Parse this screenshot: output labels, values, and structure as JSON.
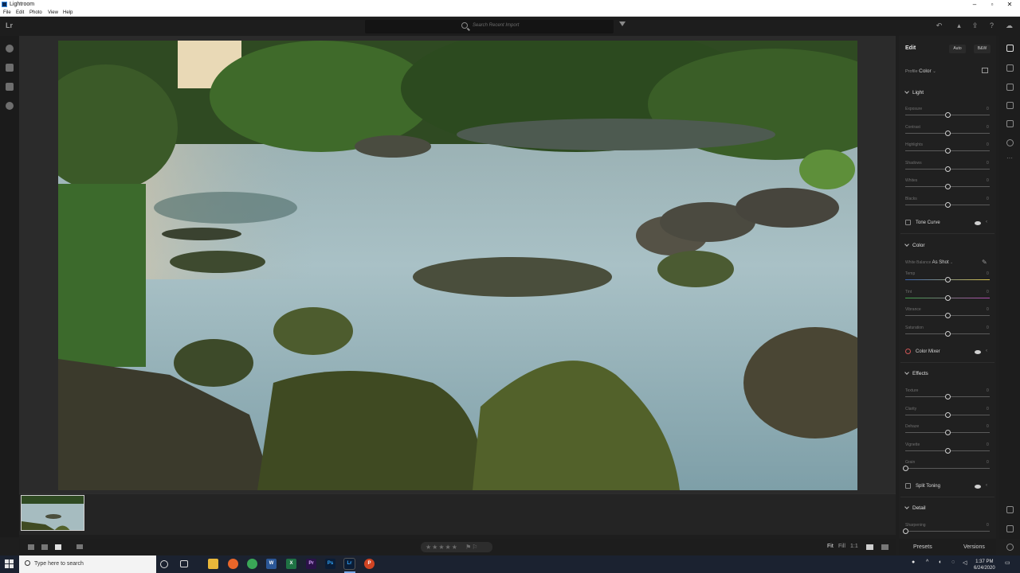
{
  "window": {
    "title": "Lightroom"
  },
  "menu": [
    "File",
    "Edit",
    "Photo",
    "View",
    "Help"
  ],
  "topbar": {
    "logo": "Lr",
    "search_placeholder": "Search Recent Import"
  },
  "edit_panel": {
    "title": "Edit",
    "auto_label": "Auto",
    "bw_label": "B&W",
    "profile_label": "Profile",
    "profile_value": "Color",
    "sections": {
      "light": {
        "title": "Light",
        "sliders": [
          {
            "label": "Exposure",
            "value": "0",
            "level": 0.5
          },
          {
            "label": "Contrast",
            "value": "0",
            "level": 0.5
          },
          {
            "label": "Highlights",
            "value": "0",
            "level": 0.5
          },
          {
            "label": "Shadows",
            "value": "0",
            "level": 0.5
          },
          {
            "label": "Whites",
            "value": "0",
            "level": 0.5
          },
          {
            "label": "Blacks",
            "value": "0",
            "level": 0.5
          }
        ],
        "tone_curve": "Tone Curve"
      },
      "color": {
        "title": "Color",
        "white_balance_label": "White Balance",
        "white_balance_value": "As Shot",
        "sliders": [
          {
            "label": "Temp",
            "value": "0",
            "level": 0.5
          },
          {
            "label": "Tint",
            "value": "0",
            "level": 0.5
          },
          {
            "label": "Vibrance",
            "value": "0",
            "level": 0.5
          },
          {
            "label": "Saturation",
            "value": "0",
            "level": 0.5
          }
        ],
        "color_mixer": "Color Mixer"
      },
      "effects": {
        "title": "Effects",
        "sliders": [
          {
            "label": "Texture",
            "value": "0",
            "level": 0.5
          },
          {
            "label": "Clarity",
            "value": "0",
            "level": 0.5
          },
          {
            "label": "Dehaze",
            "value": "0",
            "level": 0.5
          },
          {
            "label": "Vignette",
            "value": "0",
            "level": 0.5
          },
          {
            "label": "Grain",
            "value": "0",
            "level": 0.0
          }
        ],
        "split_toning": "Split Toning"
      },
      "detail": {
        "title": "Detail",
        "sliders": [
          {
            "label": "Sharpening",
            "value": "0",
            "level": 0.0
          }
        ]
      }
    },
    "tabs": {
      "presets": "Presets",
      "versions": "Versions"
    }
  },
  "bottombar": {
    "stars": "★★★★★",
    "fit": "Fit",
    "fill": "Fill",
    "one_to_one": "1:1"
  },
  "taskbar": {
    "search_placeholder": "Type here to search",
    "time": "1:37 PM",
    "date": "6/24/2020"
  }
}
